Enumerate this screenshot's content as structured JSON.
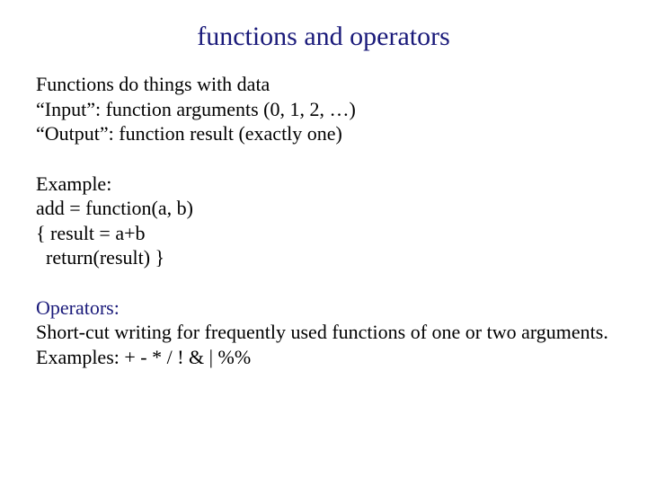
{
  "title": "functions and operators",
  "intro": {
    "line1": "Functions do things with data",
    "line2": "“Input”: function arguments (0, 1, 2, …)",
    "line3": "“Output”: function result (exactly one)"
  },
  "example": {
    "heading": "Example:",
    "line1": "add = function(a, b)",
    "line2": "{ result = a+b",
    "line3": "  return(result) }"
  },
  "operators": {
    "heading": "Operators:",
    "line1": "Short-cut writing for frequently used functions of one or two arguments.",
    "line2": "Examples: + - * / ! & | %%"
  }
}
